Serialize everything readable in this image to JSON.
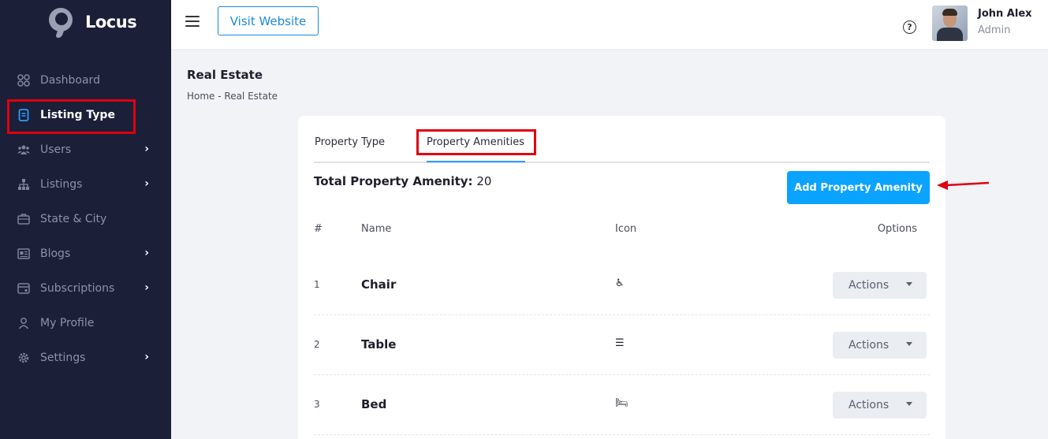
{
  "brand": {
    "name": "Locus"
  },
  "sidebar": {
    "items": [
      {
        "label": "Dashboard",
        "icon": "grid-icon",
        "has_submenu": false
      },
      {
        "label": "Listing Type",
        "icon": "document-icon",
        "has_submenu": false,
        "active": true
      },
      {
        "label": "Users",
        "icon": "users-icon",
        "has_submenu": true
      },
      {
        "label": "Listings",
        "icon": "sitemap-icon",
        "has_submenu": true
      },
      {
        "label": "State & City",
        "icon": "briefcase-icon",
        "has_submenu": false
      },
      {
        "label": "Blogs",
        "icon": "newspaper-icon",
        "has_submenu": true
      },
      {
        "label": "Subscriptions",
        "icon": "card-icon",
        "has_submenu": true
      },
      {
        "label": "My Profile",
        "icon": "person-icon",
        "has_submenu": false
      },
      {
        "label": "Settings",
        "icon": "gear-icon",
        "has_submenu": true
      }
    ]
  },
  "topbar": {
    "visit_label": "Visit Website",
    "help_glyph": "?",
    "user_name": "John Alex",
    "user_role": "Admin"
  },
  "page": {
    "title": "Real Estate",
    "breadcrumb": "Home - Real Estate"
  },
  "tabs": [
    {
      "label": "Property Type",
      "active": false
    },
    {
      "label": "Property Amenities",
      "active": true
    }
  ],
  "summary": {
    "label": "Total Property Amenity:",
    "value": "20"
  },
  "add_button_label": "Add Property Amenity",
  "table": {
    "headers": [
      "#",
      "Name",
      "Icon",
      "Options"
    ],
    "rows": [
      {
        "num": "1",
        "name": "Chair",
        "icon_glyph": "♿",
        "action_label": "Actions"
      },
      {
        "num": "2",
        "name": "Table",
        "icon_glyph": "☰",
        "action_label": "Actions"
      },
      {
        "num": "3",
        "name": "Bed",
        "icon_glyph": "🛏",
        "action_label": "Actions"
      }
    ]
  },
  "colors": {
    "sidebar_bg": "#1b1f38",
    "accent": "#0aa3ff",
    "highlight": "#e0000f"
  }
}
